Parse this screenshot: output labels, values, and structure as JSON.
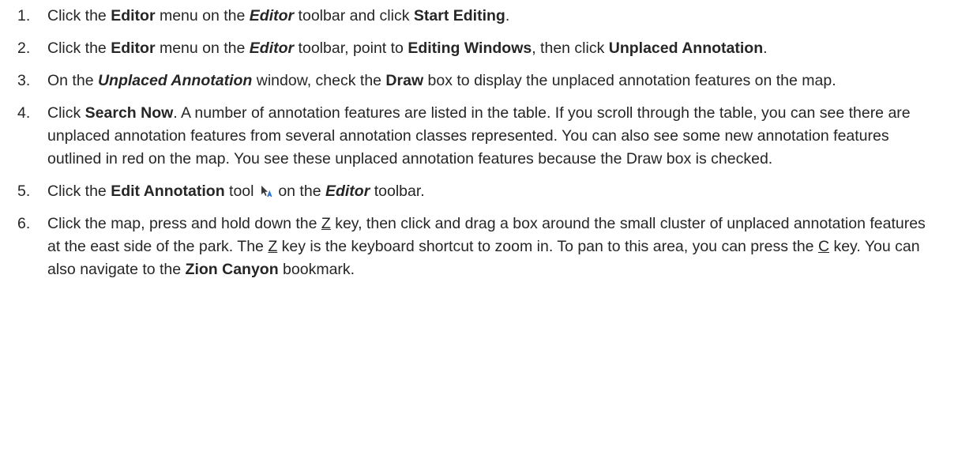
{
  "steps": [
    {
      "num": "1.",
      "t1": "Click the ",
      "b1": "Editor",
      "t2": " menu on the ",
      "bi1": "Editor",
      "t3": " toolbar and click ",
      "b2": "Start Editing",
      "t4": "."
    },
    {
      "num": "2.",
      "t1": "Click the ",
      "b1": "Editor",
      "t2": " menu on the ",
      "bi1": "Editor",
      "t3": " toolbar, point to ",
      "b2": "Editing Windows",
      "t4": ", then click ",
      "b3": "Unplaced Annotation",
      "t5": "."
    },
    {
      "num": "3.",
      "t1": "On the ",
      "bi1": "Unplaced Annotation",
      "t2": " window, check the ",
      "b1": "Draw",
      "t3": " box to display the unplaced annotation features on the map."
    },
    {
      "num": "4.",
      "t1": "Click ",
      "b1": "Search Now",
      "t2": ". A number of annotation features are listed in the table. If you scroll through the table, you can see there are unplaced annotation features from several annotation classes represented. You can also see some new annotation features outlined in red on the map. You see these unplaced annotation features because the Draw box is checked."
    },
    {
      "num": "5.",
      "t1": "Click the ",
      "b1": "Edit Annotation",
      "t2": " tool ",
      "icon": "edit-annotation-tool-icon",
      "t3": " on the ",
      "bi1": "Editor",
      "t4": " toolbar."
    },
    {
      "num": "6.",
      "t1": "Click the map, press and hold down the ",
      "u1": "Z",
      "t2": " key, then click and drag a box around the small cluster of unplaced annotation features at the east side of the park. The ",
      "u2": "Z",
      "t3": " key is the keyboard shortcut to zoom in. To pan to this area, you can press the ",
      "u3": "C",
      "t4": " key. You can also navigate to the ",
      "b1": "Zion Canyon",
      "t5": " bookmark."
    }
  ],
  "colors": {
    "text": "#262626",
    "icon_arrow": "#3a3a3a",
    "icon_letter": "#1f6fd6"
  }
}
